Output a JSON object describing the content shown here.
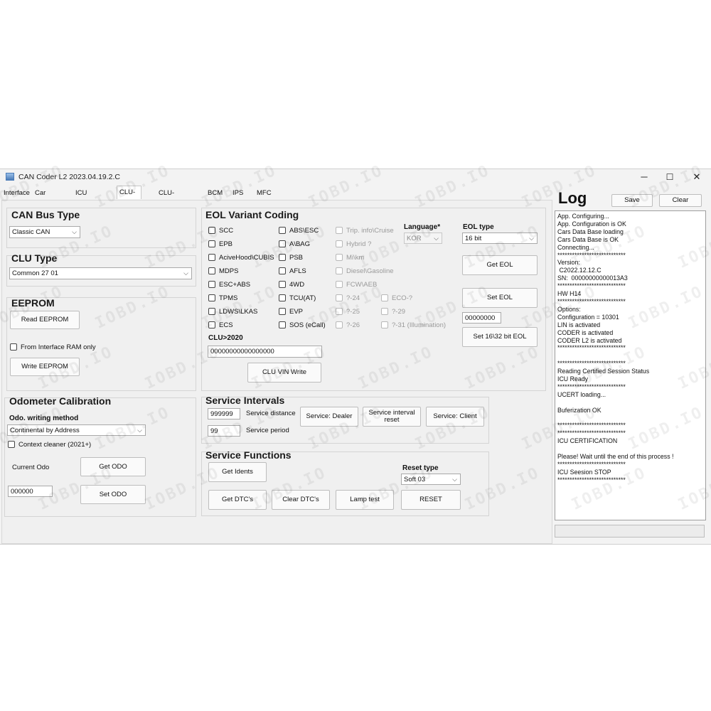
{
  "window": {
    "title": "CAN Coder L2 2023.04.19.2.C",
    "minimize": "─",
    "maximize": "☐",
    "close": "✕"
  },
  "tabs": [
    "Interface",
    "Car selector",
    "ICU Gateway",
    "CLU-Based",
    "CLU-Additional",
    "BCM",
    "IPS",
    "MFC"
  ],
  "active_tab": "CLU-Based",
  "can_bus": {
    "title": "CAN Bus Type",
    "value": "Classic CAN"
  },
  "clu_type": {
    "title": "CLU Type",
    "value": "Common 27 01"
  },
  "eeprom": {
    "title": "EEPROM",
    "read_button": "Read EEPROM",
    "ram_checkbox": "From Interface RAM only",
    "write_button": "Write EEPROM"
  },
  "odometer": {
    "title": "Odometer Calibration",
    "method_label": "Odo. writing method",
    "method_value": "Continental by Address",
    "context_checkbox": "Context cleaner (2021+)",
    "current_label": "Current Odo",
    "get_button": "Get ODO",
    "value": "000000",
    "set_button": "Set ODO"
  },
  "eol": {
    "title": "EOL Variant Coding",
    "col1": [
      "SCC",
      "EPB",
      "AciveHood\\CUBIS",
      "MDPS",
      "ESC+ABS",
      "TPMS",
      "LDWS\\LKAS",
      "ECS"
    ],
    "col2": [
      "ABS\\ESC",
      "A\\BAG",
      "PSB",
      "AFLS",
      "4WD",
      "TCU(AT)",
      "EVP",
      "SOS (eCall)"
    ],
    "col3": [
      "Trip. info\\Cruise",
      "Hybrid ?",
      "Mi\\km",
      "Diesel\\Gasoline",
      "FCW\\AEB",
      "?-24",
      "?-25",
      "?-26"
    ],
    "col4": [
      "ECO-?",
      "?-29",
      "?-31 (Illumination)"
    ],
    "language_label": "Language*",
    "language_value": "KOR",
    "eol_type_label": "EOL type",
    "eol_type_value": "16 bit",
    "get_eol_button": "Get EOL",
    "set_eol_button": "Set EOL",
    "eol_value": "00000000",
    "set_1632_button": "Set 16\\32 bit   EOL",
    "clu2020_label": "CLU>2020",
    "vin_value": "00000000000000000",
    "clu_vin_button": "CLU VIN Write"
  },
  "service_intervals": {
    "title": "Service Intervals",
    "distance_value": "999999",
    "distance_label": "Service distance",
    "period_value": "99",
    "period_label": "Service period",
    "dealer_button": "Service: Dealer",
    "reset_button": "Service interval reset",
    "client_button": "Service: Client"
  },
  "service_functions": {
    "title": "Service Functions",
    "get_idents": "Get Idents",
    "reset_type_label": "Reset type",
    "reset_type_value": "Soft 03",
    "get_dtc": "Get DTC's",
    "clear_dtc": "Clear DTC's",
    "lamp_test": "Lamp test",
    "reset": "RESET"
  },
  "log": {
    "title": "Log",
    "save_button": "Save",
    "clear_button": "Clear",
    "text": "App. Configuring...\nApp. Configuration is OK\nCars Data Base loading\nCars Data Base is OK\nConnecting...\n****************************\nVersion:\n C2022.12.12.C\nSN:  00000000000013A3\n****************************\nHW H14\n****************************\nOptions:\nConfiguration = 10301\nLIN is activated\nCODER is activated\nCODER L2 is activated\n****************************\n\n****************************\nReading Certified Session Status\nICU Ready\n****************************\nUCERT loading...\n\nBuferization OK\n\n****************************\n****************************\nICU CERTIFICATION\n\nPlease! Wait until the end of this process !\n****************************\nICU Seesion STOP\n****************************"
  },
  "watermark": "IOBD.IO"
}
